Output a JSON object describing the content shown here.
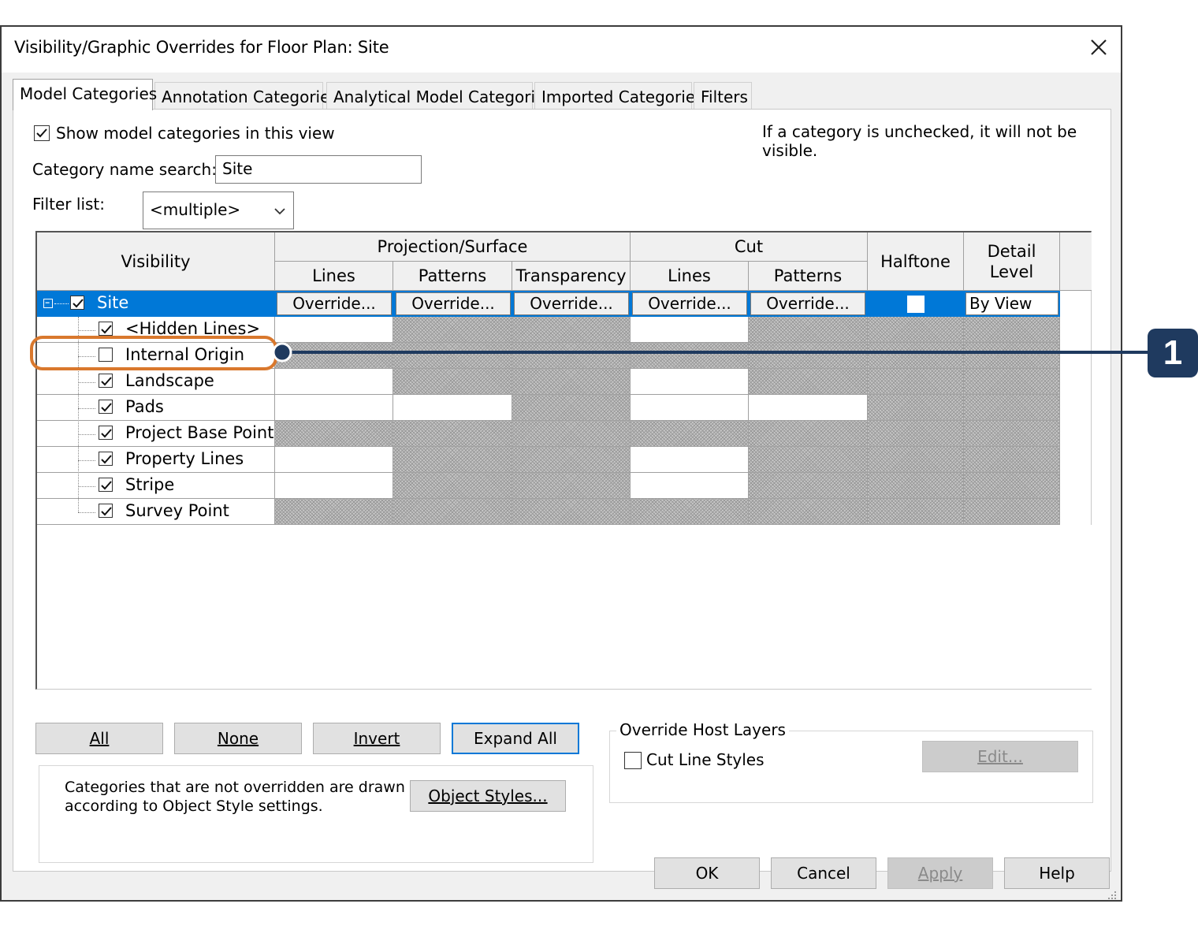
{
  "window": {
    "title": "Visibility/Graphic Overrides for Floor Plan: Site"
  },
  "tabs": [
    {
      "label": "Model Categories",
      "active": true
    },
    {
      "label": "Annotation Categories",
      "active": false
    },
    {
      "label": "Analytical Model Categories",
      "active": false
    },
    {
      "label": "Imported Categories",
      "active": false
    },
    {
      "label": "Filters",
      "active": false
    }
  ],
  "options": {
    "show_model_categories_label": "Show model categories in this view",
    "show_model_categories_checked": true,
    "hint": "If a category is unchecked, it will not be visible.",
    "search_label": "Category name search:",
    "search_value": "Site",
    "filter_label": "Filter list:",
    "filter_value": "<multiple>"
  },
  "table": {
    "headers": {
      "visibility": "Visibility",
      "projection_surface": "Projection/Surface",
      "cut": "Cut",
      "halftone": "Halftone",
      "detail_level": "Detail Level",
      "lines": "Lines",
      "patterns": "Patterns",
      "transparency": "Transparency",
      "cut_lines": "Lines",
      "cut_patterns": "Patterns"
    },
    "parent_row": {
      "name": "Site",
      "checked": true,
      "override_label": "Override...",
      "halftone_checked": false,
      "detail_level": "By View"
    },
    "children": [
      {
        "name": "<Hidden Lines>",
        "checked": true
      },
      {
        "name": "Internal Origin",
        "checked": false
      },
      {
        "name": "Landscape",
        "checked": true
      },
      {
        "name": "Pads",
        "checked": true
      },
      {
        "name": "Project Base Point",
        "checked": true
      },
      {
        "name": "Property Lines",
        "checked": true
      },
      {
        "name": "Stripe",
        "checked": true
      },
      {
        "name": "Survey Point",
        "checked": true
      }
    ]
  },
  "buttons": {
    "all": "All",
    "none": "None",
    "invert": "Invert",
    "expand_all": "Expand All",
    "object_styles": "Object Styles...",
    "edit": "Edit...",
    "ok": "OK",
    "cancel": "Cancel",
    "apply": "Apply",
    "help": "Help"
  },
  "notes": {
    "object_style_note_line1": "Categories that are not overridden are drawn",
    "object_style_note_line2": "according to Object Style settings."
  },
  "host_layers": {
    "group_label": "Override Host Layers",
    "cut_line_styles_label": "Cut Line Styles",
    "cut_line_styles_checked": false
  },
  "callout": {
    "number": "1"
  },
  "colors": {
    "selection": "#0078d7",
    "callout_orange": "#d9782d",
    "callout_navy": "#1f3a5f"
  }
}
